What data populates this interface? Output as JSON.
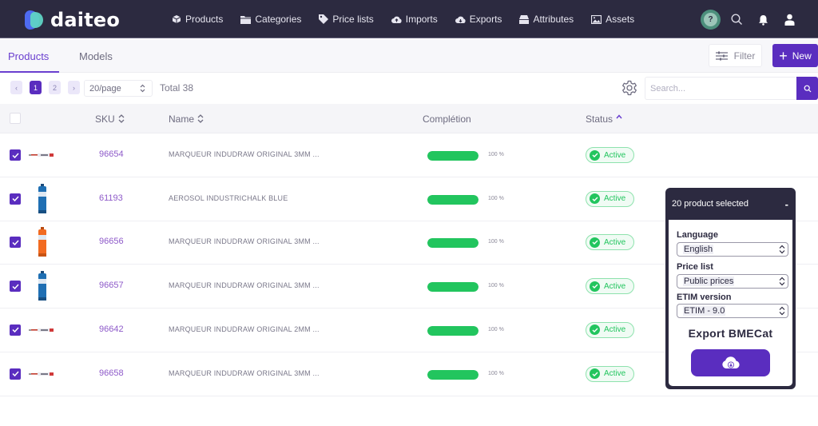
{
  "app": {
    "brand": "daiteo"
  },
  "nav": {
    "items": [
      {
        "label": "Products",
        "icon": "cube-icon"
      },
      {
        "label": "Categories",
        "icon": "folder-icon"
      },
      {
        "label": "Price lists",
        "icon": "tag-icon"
      },
      {
        "label": "Imports",
        "icon": "cloud-upload-icon"
      },
      {
        "label": "Exports",
        "icon": "cloud-download-icon"
      },
      {
        "label": "Attributes",
        "icon": "tray-icon"
      },
      {
        "label": "Assets",
        "icon": "image-icon"
      }
    ],
    "help_label": "?"
  },
  "tabs": [
    {
      "label": "Products",
      "active": true
    },
    {
      "label": "Models",
      "active": false
    }
  ],
  "actions": {
    "filter_label": "Filter",
    "new_label": "New"
  },
  "toolbar": {
    "pages": [
      "1",
      "2"
    ],
    "current_page": "1",
    "prev_label": "‹",
    "next_label": "›",
    "per_page": "20/page",
    "total": "Total 38",
    "search_placeholder": "Search..."
  },
  "table": {
    "columns": {
      "sku": "SKU",
      "name": "Name",
      "completion": "Complétion",
      "status": "Status"
    },
    "rows": [
      {
        "sku": "96654",
        "name": "MARQUEUR INDUDRAW ORIGINAL 3MM ...",
        "completion": 100,
        "completion_label": "100 %",
        "status": "Active",
        "checked": true,
        "thumb": "marker"
      },
      {
        "sku": "61193",
        "name": "AEROSOL INDUSTRICHALK BLUE",
        "completion": 100,
        "completion_label": "100 %",
        "status": "Active",
        "checked": true,
        "thumb": "can-blue"
      },
      {
        "sku": "96656",
        "name": "MARQUEUR INDUDRAW ORIGINAL 3MM ...",
        "completion": 100,
        "completion_label": "100 %",
        "status": "Active",
        "checked": true,
        "thumb": "can-orange"
      },
      {
        "sku": "96657",
        "name": "MARQUEUR INDUDRAW ORIGINAL 3MM ...",
        "completion": 100,
        "completion_label": "100 %",
        "status": "Active",
        "checked": true,
        "thumb": "can-blue"
      },
      {
        "sku": "96642",
        "name": "MARQUEUR INDUDRAW ORIGINAL 2MM ...",
        "completion": 100,
        "completion_label": "100 %",
        "status": "Active",
        "checked": true,
        "thumb": "marker"
      },
      {
        "sku": "96658",
        "name": "MARQUEUR INDUDRAW ORIGINAL 3MM ...",
        "completion": 100,
        "completion_label": "100 %",
        "status": "Active",
        "checked": true,
        "thumb": "marker"
      }
    ]
  },
  "export_panel": {
    "title": "20 product selected",
    "collapse_label": "-",
    "language_label": "Language",
    "language_value": "English",
    "price_list_label": "Price list",
    "price_list_value": "Public prices",
    "etim_label": "ETIM version",
    "etim_value": "ETIM - 9.0",
    "export_title": "Export BMECat"
  },
  "colors": {
    "brand_purple": "#5a2dbf",
    "topbar": "#2c2a40",
    "success": "#22c55e",
    "sku_link": "#8e5ac9"
  }
}
